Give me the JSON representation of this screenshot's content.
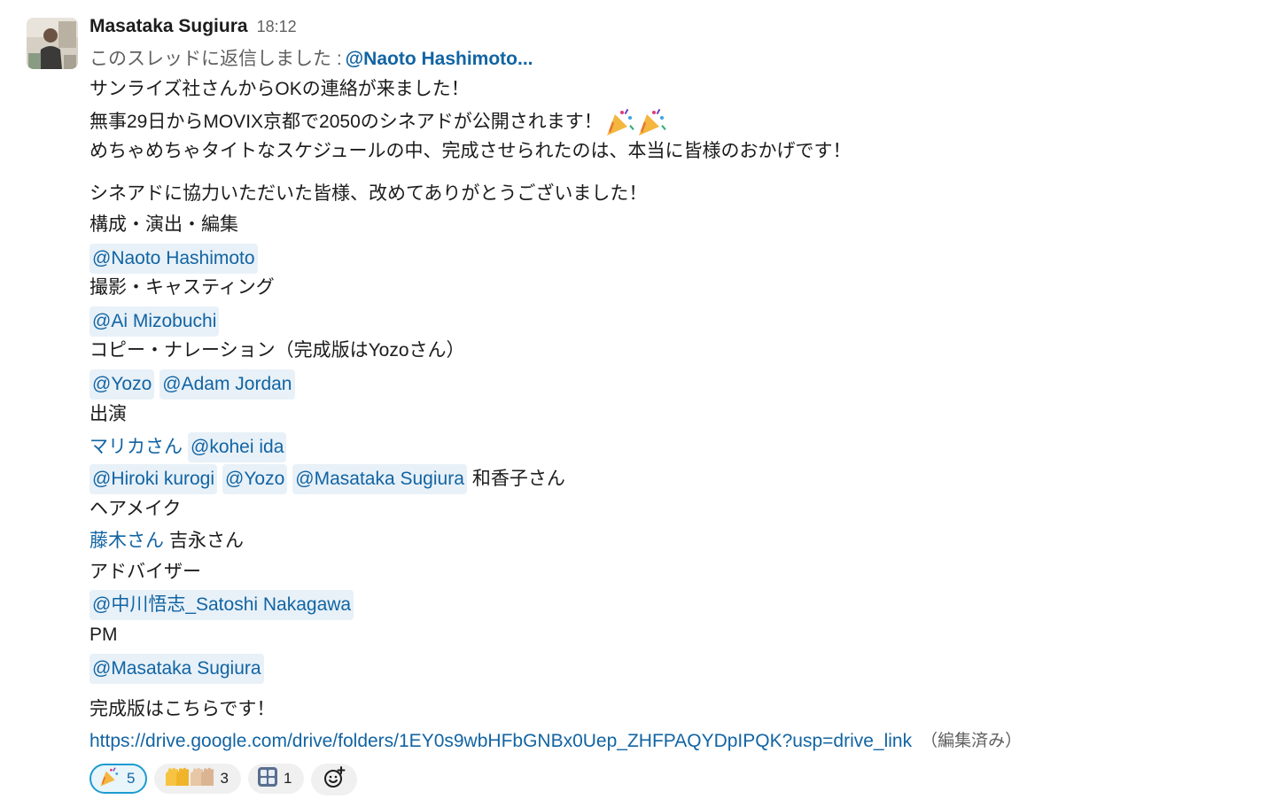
{
  "message": {
    "author": "Masataka Sugiura",
    "time": "18:12",
    "thread_note": "このスレッドに返信しました :",
    "thread_link": "@Naoto Hashimoto...",
    "line1": "サンライズ社さんからOKの連絡が来ました！",
    "line2": "無事29日からMOVIX京都で2050のシネアドが公開されます！",
    "line3": "めちゃめちゃタイトなスケジュールの中、完成させられたのは、本当に皆様のおかげです！",
    "line4": "シネアドに協力いただいた皆様、改めてありがとうございました！",
    "section_composition": "構成・演出・編集",
    "mention_naoto": "@Naoto Hashimoto",
    "section_camera": "撮影・キャスティング",
    "mention_ai": "@Ai Mizobuchi",
    "section_copy": "コピー・ナレーション（完成版はYozoさん）",
    "mention_yozo_1": "@Yozo",
    "mention_adam": "@Adam Jordan",
    "section_cast": "出演",
    "link_marika": "マリカさん",
    "mention_kohei": "@kohei ida",
    "mention_hiroki": "@Hiroki kurogi",
    "mention_yozo_2": "@Yozo",
    "mention_masataka_1": "@Masataka Sugiura",
    "text_wakako": "和香子さん",
    "section_hair": "ヘアメイク",
    "link_fujiki": "藤木さん",
    "text_yoshinaga": "吉永さん",
    "section_advisor": "アドバイザー",
    "mention_nakagawa": "@中川悟志_Satoshi Nakagawa",
    "section_pm": "PM",
    "mention_masataka_2": "@Masataka Sugiura",
    "final_line": "完成版はこちらです！",
    "drive_url": "https://drive.google.com/drive/folders/1EY0s9wbHFbGNBx0Uep_ZHFPAQYDpIPQK?usp=drive_link",
    "edited": "（編集済み）"
  },
  "reactions": [
    {
      "icon": "party-popper-icon",
      "count": "5",
      "active": true
    },
    {
      "icon": "raised-hands-icon",
      "count": "3",
      "active": false
    },
    {
      "icon": "custom-emoji-icon",
      "count": "1",
      "active": false
    }
  ],
  "colors": {
    "link": "#1264a3",
    "mention_bg": "#e8f1f8",
    "muted": "#616061",
    "text": "#1d1c1d",
    "active_reaction_border": "#1d9bd1"
  }
}
